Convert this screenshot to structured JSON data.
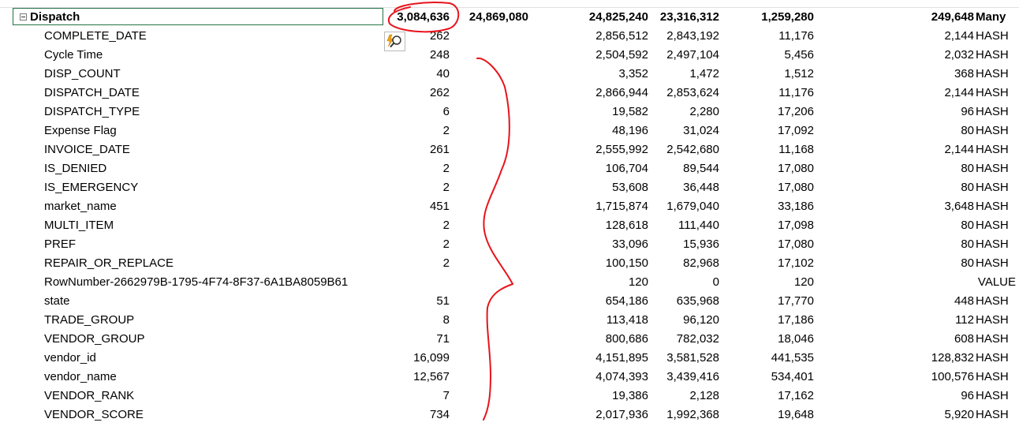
{
  "header": {
    "name": "Dispatch",
    "cardinality": "3,084,636",
    "col_b": "24,869,080",
    "col_d": "24,825,240",
    "col_e": "23,316,312",
    "col_f": "1,259,280",
    "col_g": "249,648",
    "type": "Many"
  },
  "rows": [
    {
      "name": "COMPLETE_DATE",
      "cardinality": "262",
      "col_d": "2,856,512",
      "col_e": "2,843,192",
      "col_f": "11,176",
      "col_g": "2,144",
      "type": "HASH"
    },
    {
      "name": "Cycle Time",
      "cardinality": "248",
      "col_d": "2,504,592",
      "col_e": "2,497,104",
      "col_f": "5,456",
      "col_g": "2,032",
      "type": "HASH"
    },
    {
      "name": "DISP_COUNT",
      "cardinality": "40",
      "col_d": "3,352",
      "col_e": "1,472",
      "col_f": "1,512",
      "col_g": "368",
      "type": "HASH"
    },
    {
      "name": "DISPATCH_DATE",
      "cardinality": "262",
      "col_d": "2,866,944",
      "col_e": "2,853,624",
      "col_f": "11,176",
      "col_g": "2,144",
      "type": "HASH"
    },
    {
      "name": "DISPATCH_TYPE",
      "cardinality": "6",
      "col_d": "19,582",
      "col_e": "2,280",
      "col_f": "17,206",
      "col_g": "96",
      "type": "HASH"
    },
    {
      "name": "Expense Flag",
      "cardinality": "2",
      "col_d": "48,196",
      "col_e": "31,024",
      "col_f": "17,092",
      "col_g": "80",
      "type": "HASH"
    },
    {
      "name": "INVOICE_DATE",
      "cardinality": "261",
      "col_d": "2,555,992",
      "col_e": "2,542,680",
      "col_f": "11,168",
      "col_g": "2,144",
      "type": "HASH"
    },
    {
      "name": "IS_DENIED",
      "cardinality": "2",
      "col_d": "106,704",
      "col_e": "89,544",
      "col_f": "17,080",
      "col_g": "80",
      "type": "HASH"
    },
    {
      "name": "IS_EMERGENCY",
      "cardinality": "2",
      "col_d": "53,608",
      "col_e": "36,448",
      "col_f": "17,080",
      "col_g": "80",
      "type": "HASH"
    },
    {
      "name": "market_name",
      "cardinality": "451",
      "col_d": "1,715,874",
      "col_e": "1,679,040",
      "col_f": "33,186",
      "col_g": "3,648",
      "type": "HASH"
    },
    {
      "name": "MULTI_ITEM",
      "cardinality": "2",
      "col_d": "128,618",
      "col_e": "111,440",
      "col_f": "17,098",
      "col_g": "80",
      "type": "HASH"
    },
    {
      "name": "PREF",
      "cardinality": "2",
      "col_d": "33,096",
      "col_e": "15,936",
      "col_f": "17,080",
      "col_g": "80",
      "type": "HASH"
    },
    {
      "name": "REPAIR_OR_REPLACE",
      "cardinality": "2",
      "col_d": "100,150",
      "col_e": "82,968",
      "col_f": "17,102",
      "col_g": "80",
      "type": "HASH"
    },
    {
      "name": "RowNumber-2662979B-1795-4F74-8F37-6A1BA8059B61",
      "cardinality": "",
      "col_d": "120",
      "col_e": "0",
      "col_f": "120",
      "col_g": "",
      "type": "VALUE"
    },
    {
      "name": "state",
      "cardinality": "51",
      "col_d": "654,186",
      "col_e": "635,968",
      "col_f": "17,770",
      "col_g": "448",
      "type": "HASH"
    },
    {
      "name": "TRADE_GROUP",
      "cardinality": "8",
      "col_d": "113,418",
      "col_e": "96,120",
      "col_f": "17,186",
      "col_g": "112",
      "type": "HASH"
    },
    {
      "name": "VENDOR_GROUP",
      "cardinality": "71",
      "col_d": "800,686",
      "col_e": "782,032",
      "col_f": "18,046",
      "col_g": "608",
      "type": "HASH"
    },
    {
      "name": "vendor_id",
      "cardinality": "16,099",
      "col_d": "4,151,895",
      "col_e": "3,581,528",
      "col_f": "441,535",
      "col_g": "128,832",
      "type": "HASH"
    },
    {
      "name": "vendor_name",
      "cardinality": "12,567",
      "col_d": "4,074,393",
      "col_e": "3,439,416",
      "col_f": "534,401",
      "col_g": "100,576",
      "type": "HASH"
    },
    {
      "name": "VENDOR_RANK",
      "cardinality": "7",
      "col_d": "19,386",
      "col_e": "2,128",
      "col_f": "17,162",
      "col_g": "96",
      "type": "HASH"
    },
    {
      "name": "VENDOR_SCORE",
      "cardinality": "734",
      "col_d": "2,017,936",
      "col_e": "1,992,368",
      "col_f": "19,648",
      "col_g": "5,920",
      "type": "HASH"
    }
  ],
  "annotations": {
    "stroke_color": "#e8141c"
  },
  "icons": {
    "quick_analysis": "quick-analysis-icon",
    "collapse": "collapse-minus-icon"
  },
  "colors": {
    "selection_border": "#217346",
    "grid_line": "#e1e1e1"
  }
}
